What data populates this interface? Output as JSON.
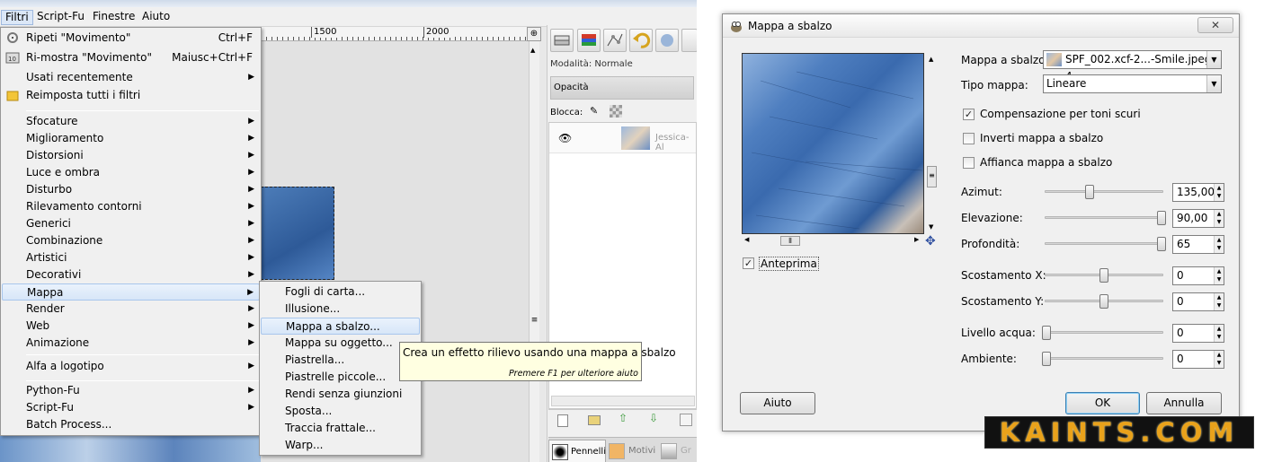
{
  "menubar": {
    "items": [
      "Filtri",
      "Script-Fu",
      "Finestre",
      "Aiuto"
    ]
  },
  "ruler": {
    "labels": [
      "1500",
      "2000"
    ]
  },
  "filters_menu": {
    "top": [
      {
        "label": "Ripeti \"Movimento\"",
        "shortcut": "Ctrl+F",
        "icon": "repeat-icon"
      },
      {
        "label": "Ri-mostra \"Movimento\"",
        "shortcut": "Maiusc+Ctrl+F",
        "icon": "reshow-icon"
      },
      {
        "label": "Usati recentemente",
        "shortcut": "",
        "icon": ""
      },
      {
        "label": "Reimposta tutti i filtri",
        "shortcut": "",
        "icon": "reset-icon"
      }
    ],
    "categories": [
      "Sfocature",
      "Miglioramento",
      "Distorsioni",
      "Luce e ombra",
      "Disturbo",
      "Rilevamento contorni",
      "Generici",
      "Combinazione",
      "Artistici",
      "Decorativi",
      "Mappa",
      "Render",
      "Web",
      "Animazione"
    ],
    "alpha": "Alfa a logotipo",
    "scripts": [
      "Python-Fu",
      "Script-Fu",
      "Batch Process..."
    ]
  },
  "map_submenu": {
    "items": [
      "Fogli di carta...",
      "Illusione...",
      "Mappa a sbalzo...",
      "Mappa su oggetto...",
      "Piastrella...",
      "Piastrelle piccole...",
      "Rendi senza giunzioni",
      "Sposta...",
      "Traccia frattale...",
      "Warp..."
    ]
  },
  "tooltip": {
    "text": "Crea un effetto rilievo usando una mappa a sbalzo",
    "hint": "Premere F1 per ulteriore aiuto"
  },
  "dock": {
    "mode_label": "Modalità:",
    "mode_value": "Normale",
    "opacity_label": "Opacità",
    "lock_label": "Blocca:",
    "layer_name": "Jessica-Al",
    "tabs": [
      "Pennelli",
      "Motivi",
      "Gr"
    ]
  },
  "dialog": {
    "title": "Mappa a sbalzo",
    "close": "✕",
    "preview_label": "Anteprima",
    "preview_checked": true,
    "bumpmap_label": "Mappa a sbalzo:",
    "bumpmap_value": "SPF_002.xcf-2...-Smile.jpeg-4",
    "maptype_label": "Tipo mappa:",
    "maptype_value": "Lineare",
    "checks": [
      {
        "label": "Compensazione per toni scuri",
        "checked": true
      },
      {
        "label": "Inverti mappa a sbalzo",
        "checked": false
      },
      {
        "label": "Affianca mappa a sbalzo",
        "checked": false
      }
    ],
    "sliders": [
      {
        "label": "Azimut:",
        "value": "135,00",
        "fraction": 0.375
      },
      {
        "label": "Elevazione:",
        "value": "90,00",
        "fraction": 1.0
      },
      {
        "label": "Profondità:",
        "value": "65",
        "fraction": 1.0
      },
      {
        "label": "Scostamento X:",
        "value": "0",
        "fraction": 0.5
      },
      {
        "label": "Scostamento Y:",
        "value": "0",
        "fraction": 0.5
      },
      {
        "label": "Livello acqua:",
        "value": "0",
        "fraction": 0.0
      },
      {
        "label": "Ambiente:",
        "value": "0",
        "fraction": 0.0
      }
    ],
    "help_button": "Aiuto",
    "ok_button": "OK",
    "cancel_button": "Annulla"
  },
  "watermark": "KAINTS.COM"
}
